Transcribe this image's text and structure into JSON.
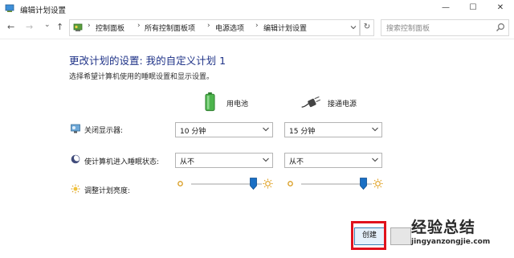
{
  "window": {
    "title": "编辑计划设置",
    "min_glyph": "—",
    "max_glyph": "☐",
    "close_glyph": "✕"
  },
  "nav": {
    "back_glyph": "←",
    "forward_glyph": "→",
    "recent_glyph": "⌄",
    "up_glyph": "↑",
    "breadcrumbs": [
      "控制面板",
      "所有控制面板项",
      "电源选项",
      "编辑计划设置"
    ],
    "breadcrumb_separator": "›",
    "refresh_glyph": "↻",
    "search_placeholder": "搜索控制面板"
  },
  "main": {
    "title": "更改计划的设置: 我的自定义计划 1",
    "subtitle": "选择希望计算机使用的睡眠设置和显示设置。",
    "columns": {
      "battery": {
        "label": "用电池",
        "icon": "battery-icon"
      },
      "plugged": {
        "label": "接通电源",
        "icon": "power-plug-icon"
      }
    },
    "rows": [
      {
        "label": "关闭显示器:",
        "icon": "display-icon",
        "battery_value": "10 分钟",
        "plugged_value": "15 分钟"
      },
      {
        "label": "使计算机进入睡眠状态:",
        "icon": "sleep-moon-icon",
        "battery_value": "从不",
        "plugged_value": "从不"
      }
    ],
    "brightness": {
      "label": "调整计划亮度:",
      "icon": "brightness-sun-icon",
      "battery_level": 0.93,
      "plugged_level": 0.93
    }
  },
  "buttons": {
    "create": "创建",
    "cancel": ""
  },
  "watermark": {
    "chinese": "经验总结",
    "pinyin": "jingyanzongjie.com"
  },
  "colors": {
    "title_blue": "#1e3287",
    "highlight_red": "#e0121d",
    "slider_thumb": "#1a6fc4",
    "battery_green": "#3aa53a"
  }
}
